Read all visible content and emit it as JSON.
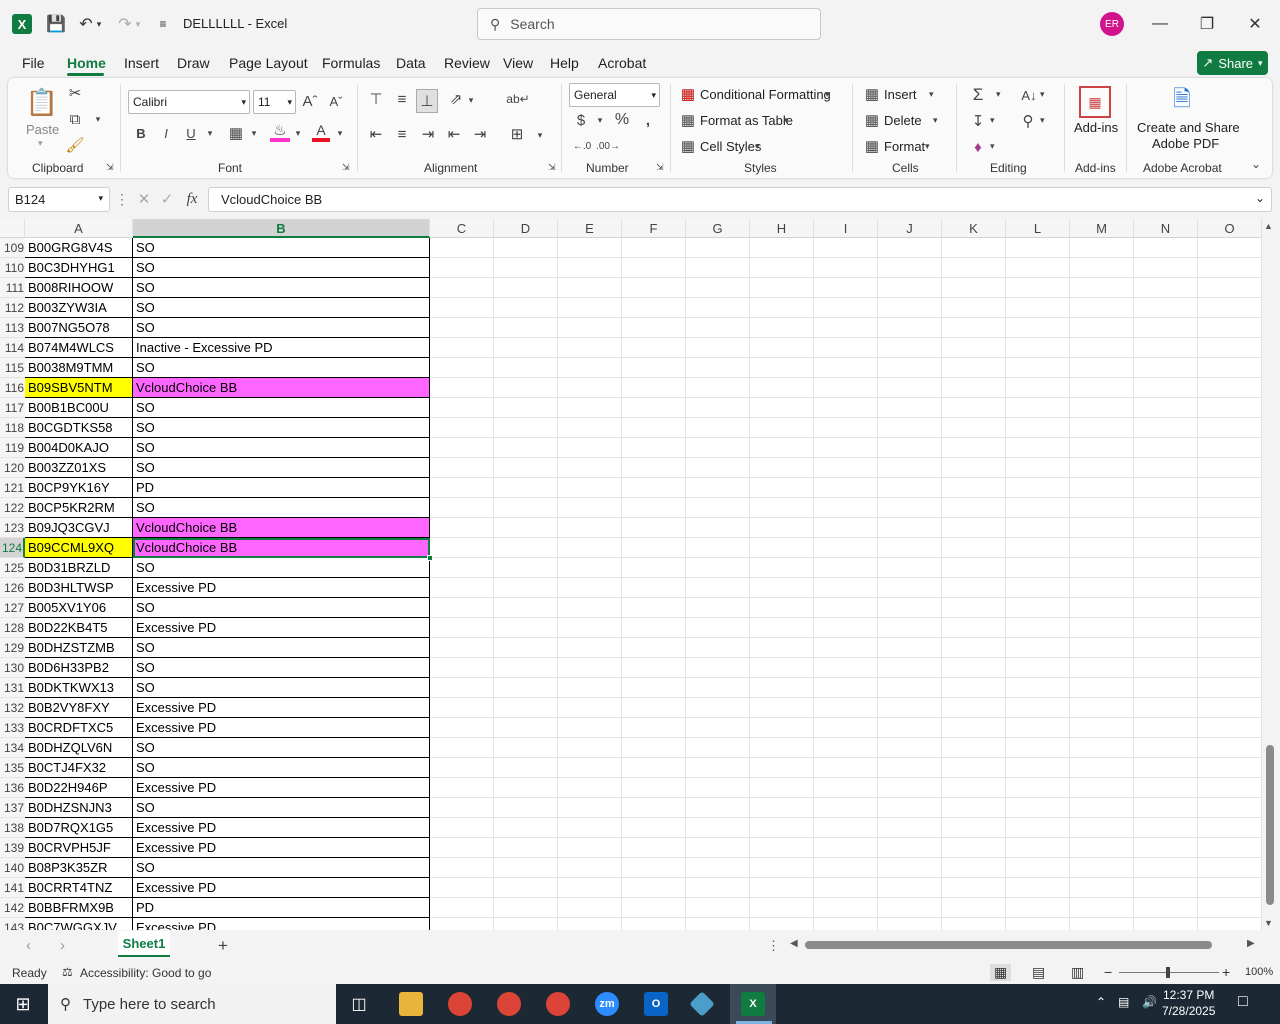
{
  "title_bar": {
    "doc_title": "DELLLLLL  -  Excel",
    "search_placeholder": "Search",
    "avatar_initials": "ER"
  },
  "menu": {
    "tabs": [
      "File",
      "Home",
      "Insert",
      "Draw",
      "Page Layout",
      "Formulas",
      "Data",
      "Review",
      "View",
      "Help",
      "Acrobat"
    ],
    "active": "Home",
    "share_label": "Share"
  },
  "ribbon": {
    "clipboard": {
      "paste": "Paste",
      "label": "Clipboard"
    },
    "font": {
      "name": "Calibri",
      "size": "11",
      "label": "Font",
      "bold": "B",
      "italic": "I",
      "underline": "U"
    },
    "alignment": {
      "label": "Alignment"
    },
    "number": {
      "format": "General",
      "label": "Number"
    },
    "styles": {
      "conditional": "Conditional Formatting",
      "table": "Format as Table",
      "cell_styles": "Cell Styles",
      "label": "Styles"
    },
    "cells": {
      "insert": "Insert",
      "delete": "Delete",
      "format": "Format",
      "label": "Cells"
    },
    "editing": {
      "label": "Editing"
    },
    "addins": {
      "button": "Add-ins",
      "label": "Add-ins"
    },
    "acrobat": {
      "button_line1": "Create and Share",
      "button_line2": "Adobe PDF",
      "label": "Adobe Acrobat"
    }
  },
  "formula_bar": {
    "name_box": "B124",
    "fx": "fx",
    "content": "VcloudChoice BB"
  },
  "columns": [
    "A",
    "B",
    "C",
    "D",
    "E",
    "F",
    "G",
    "H",
    "I",
    "J",
    "K",
    "L",
    "M",
    "N",
    "O"
  ],
  "rows": [
    {
      "n": "109",
      "a": "B00GRG8V4S",
      "b": "SO"
    },
    {
      "n": "110",
      "a": "B0C3DHYHG1",
      "b": "SO"
    },
    {
      "n": "111",
      "a": "B008RIHOOW",
      "b": "SO"
    },
    {
      "n": "112",
      "a": "B003ZYW3IA",
      "b": "SO"
    },
    {
      "n": "113",
      "a": "B007NG5O78",
      "b": "SO"
    },
    {
      "n": "114",
      "a": "B074M4WLCS",
      "b": "Inactive - Excessive PD"
    },
    {
      "n": "115",
      "a": "B0038M9TMM",
      "b": "SO"
    },
    {
      "n": "116",
      "a": "B09SBV5NTM",
      "b": "VcloudChoice BB",
      "hl": true
    },
    {
      "n": "117",
      "a": "B00B1BC00U",
      "b": "SO"
    },
    {
      "n": "118",
      "a": "B0CGDTKS58",
      "b": "SO"
    },
    {
      "n": "119",
      "a": "B004D0KAJO",
      "b": "SO"
    },
    {
      "n": "120",
      "a": "B003ZZ01XS",
      "b": "SO"
    },
    {
      "n": "121",
      "a": "B0CP9YK16Y",
      "b": "PD"
    },
    {
      "n": "122",
      "a": "B0CP5KR2RM",
      "b": "SO"
    },
    {
      "n": "123",
      "a": "B09JQ3CGVJ",
      "b": "VcloudChoice BB",
      "hlb": true
    },
    {
      "n": "124",
      "a": "B09CCML9XQ",
      "b": "VcloudChoice BB",
      "hl": true,
      "sel": true
    },
    {
      "n": "125",
      "a": "B0D31BRZLD",
      "b": "SO"
    },
    {
      "n": "126",
      "a": "B0D3HLTWSP",
      "b": "Excessive PD"
    },
    {
      "n": "127",
      "a": "B005XV1Y06",
      "b": "SO"
    },
    {
      "n": "128",
      "a": "B0D22KB4T5",
      "b": "Excessive PD"
    },
    {
      "n": "129",
      "a": "B0DHZSTZMB",
      "b": "SO"
    },
    {
      "n": "130",
      "a": "B0D6H33PB2",
      "b": "SO"
    },
    {
      "n": "131",
      "a": "B0DKTKWX13",
      "b": "SO"
    },
    {
      "n": "132",
      "a": "B0B2VY8FXY",
      "b": "Excessive PD"
    },
    {
      "n": "133",
      "a": "B0CRDFTXC5",
      "b": "Excessive PD"
    },
    {
      "n": "134",
      "a": "B0DHZQLV6N",
      "b": "SO"
    },
    {
      "n": "135",
      "a": "B0CTJ4FX32",
      "b": "SO"
    },
    {
      "n": "136",
      "a": "B0D22H946P",
      "b": "Excessive PD"
    },
    {
      "n": "137",
      "a": "B0DHZSNJN3",
      "b": "SO"
    },
    {
      "n": "138",
      "a": "B0D7RQX1G5",
      "b": "Excessive PD"
    },
    {
      "n": "139",
      "a": "B0CRVPH5JF",
      "b": "Excessive PD"
    },
    {
      "n": "140",
      "a": "B08P3K35ZR",
      "b": "SO"
    },
    {
      "n": "141",
      "a": "B0CRRT4TNZ",
      "b": "Excessive PD"
    },
    {
      "n": "142",
      "a": "B0BBFRMX9B",
      "b": "PD"
    },
    {
      "n": "143",
      "a": "B0C7WGGXJV",
      "b": "Excessive PD"
    }
  ],
  "colors": {
    "yellow": "#ffff00",
    "magenta": "#ff66ff",
    "excel_green": "#107c41"
  },
  "sheet": {
    "tab": "Sheet1"
  },
  "status": {
    "ready": "Ready",
    "accessibility": "Accessibility: Good to go",
    "zoom": "100%"
  },
  "taskbar": {
    "search_placeholder": "Type here to search",
    "time": "12:37 PM",
    "date": "7/28/2025"
  }
}
